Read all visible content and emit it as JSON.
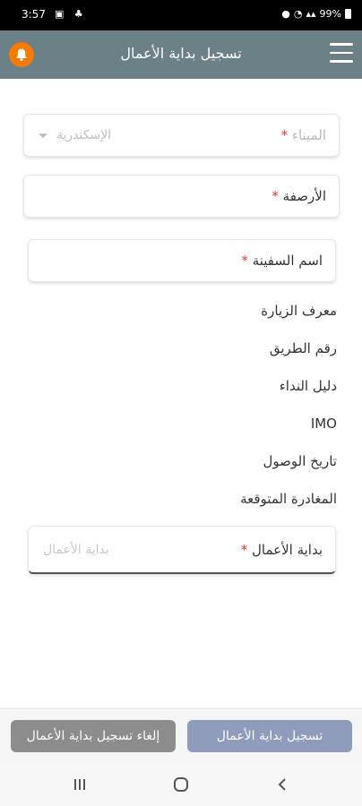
{
  "status_bar": {
    "time": "3:57",
    "battery": "99%"
  },
  "app_bar": {
    "title": "تسجيل بداية الأعمال"
  },
  "form": {
    "port": {
      "label": "الميناء",
      "required_mark": "*",
      "value": "الإسكندرية"
    },
    "berth": {
      "label": "الأرصفة",
      "required_mark": "*"
    },
    "ship_name": {
      "label": "اسم السفينة",
      "required_mark": "*"
    },
    "info_rows": [
      "معرف الزيارة",
      "رقم الطريق",
      "دليل النداء",
      "IMO",
      "تاريخ الوصول",
      "المغادرة المتوقعة"
    ],
    "work_start": {
      "label": "بداية الأعمال",
      "required_mark": "*",
      "placeholder": "بداية الأعمال"
    }
  },
  "footer": {
    "register_label": "تسجيل بداية الأعمال",
    "cancel_label": "إلغاء تسجيل بداية الأعمال"
  },
  "colors": {
    "app_bar": "#6b8087",
    "bell": "#f57c00",
    "primary_button": "#8f9bbb",
    "secondary_button": "#8c8c8c",
    "required": "#e53935"
  },
  "icons": [
    "bell-icon",
    "menu-icon",
    "dropdown-caret-icon",
    "recents-icon",
    "home-icon",
    "back-icon"
  ]
}
